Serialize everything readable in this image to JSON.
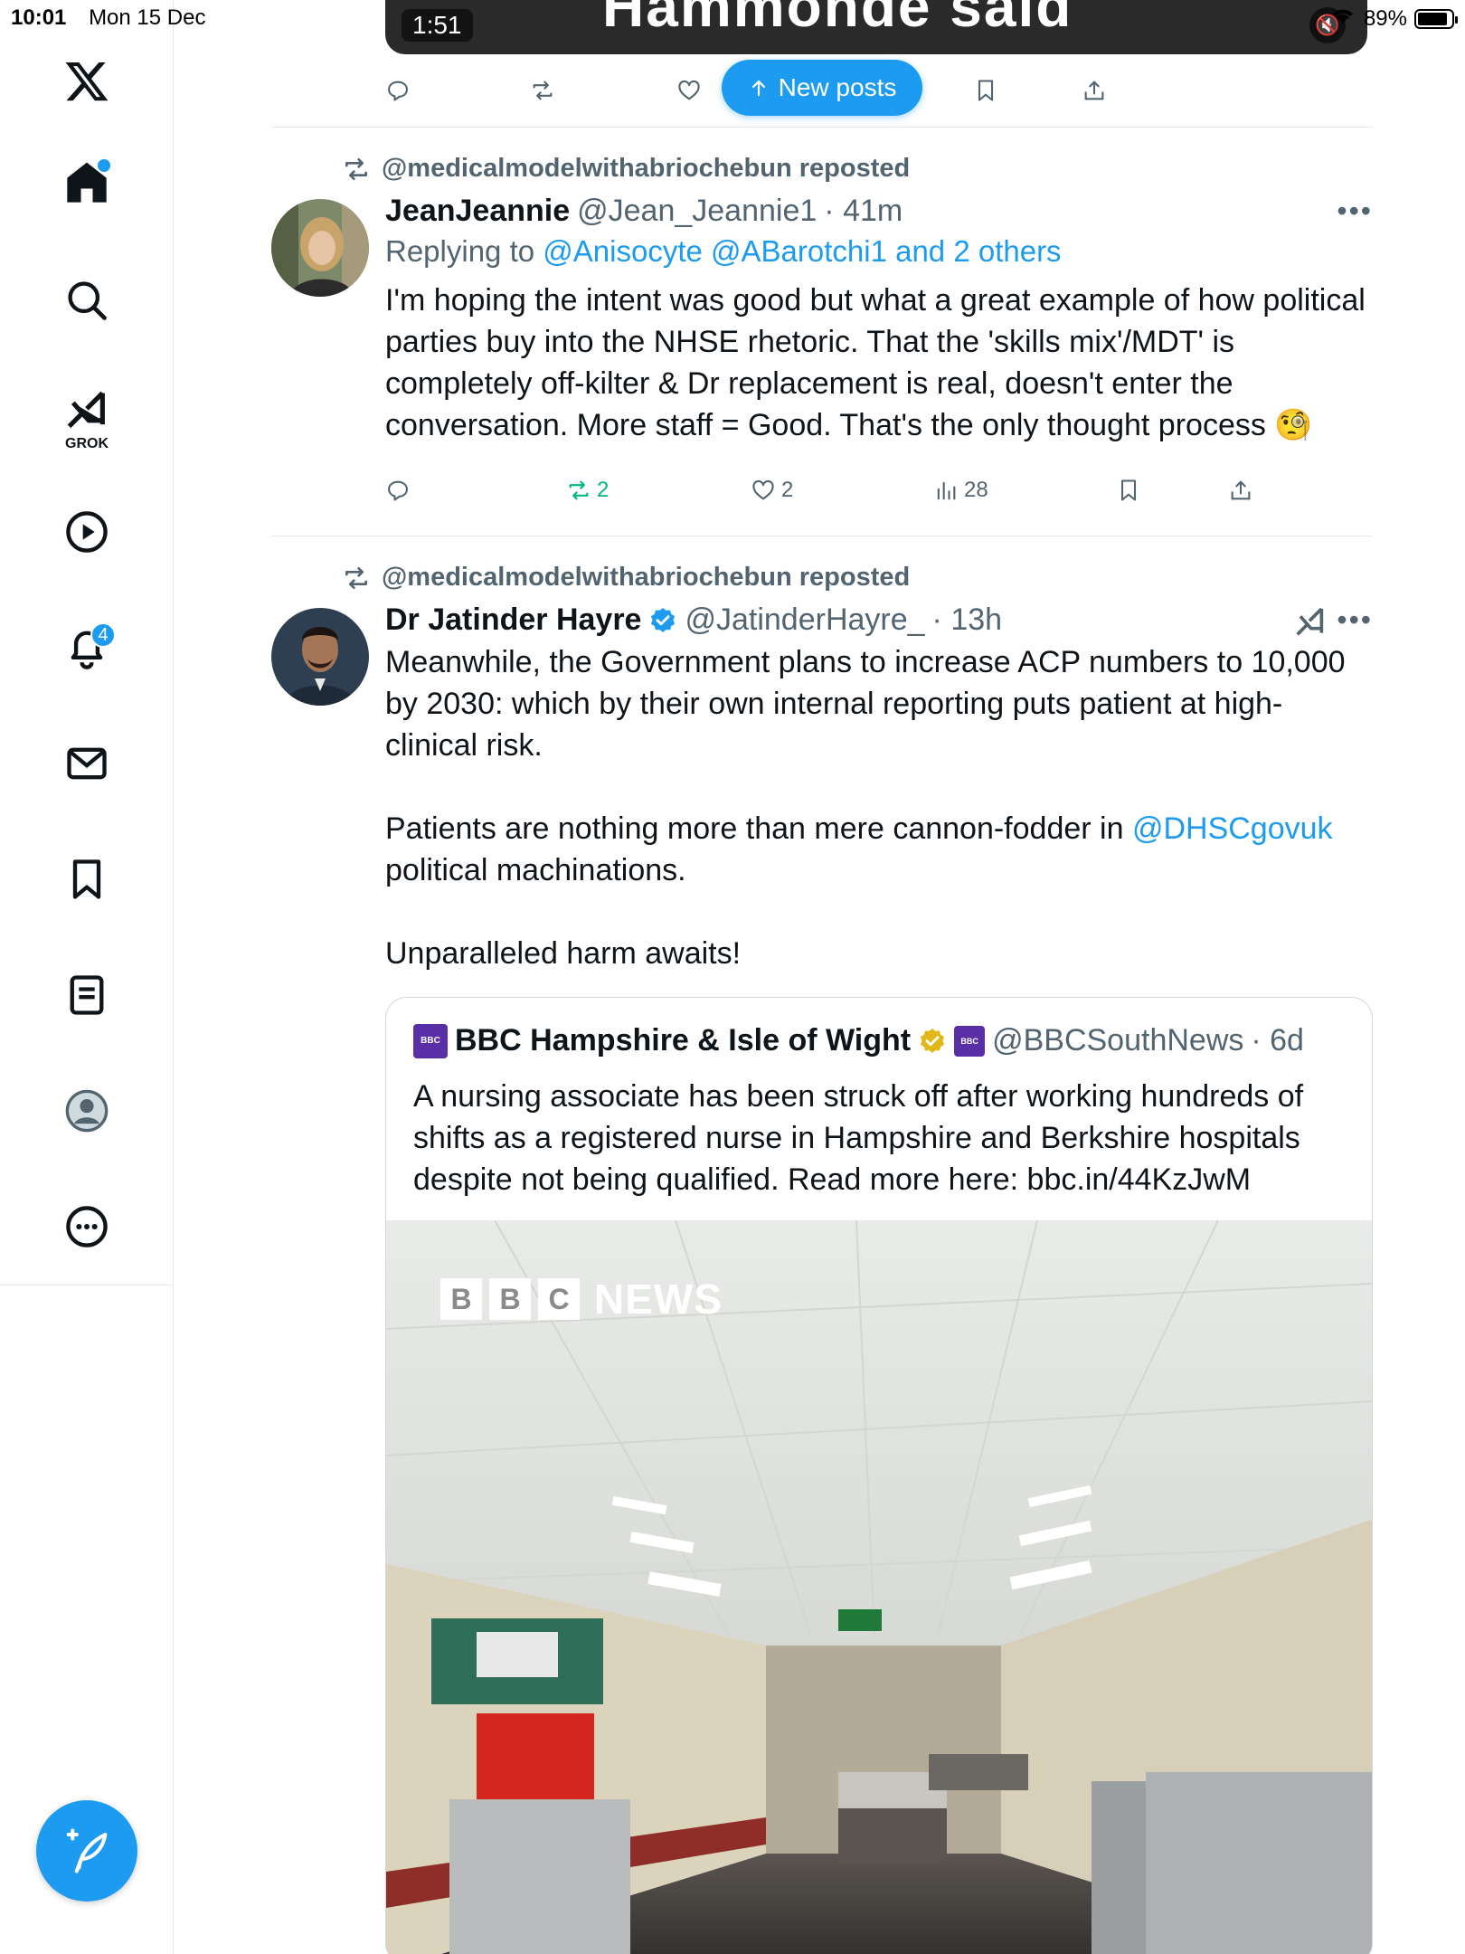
{
  "status_bar": {
    "time": "10:01",
    "date": "Mon 15 Dec",
    "battery": "89%"
  },
  "sidebar": {
    "grok_label": "GROK",
    "notifications_badge": "4"
  },
  "top_post": {
    "video_headline": "Hammonde said",
    "video_time": "1:51"
  },
  "new_posts_label": "New posts",
  "tweets": [
    {
      "repost_label": "@medicalmodelwithabriochebun reposted",
      "author": "JeanJeannie",
      "handle": "@Jean_Jeannie1",
      "time": "· 41m",
      "replying_prefix": "Replying to ",
      "replying_targets": "@Anisocyte @ABarotchi1 and 2 others",
      "text": "I'm hoping the intent was good but what a great example of how political parties buy into the NHSE rhetoric. That the 'skills mix'/MDT' is completely off-kilter & Dr replacement is real, doesn't enter the conversation. More staff = Good. That's the only thought process 🧐",
      "reposts": "2",
      "likes": "2",
      "views": "28"
    },
    {
      "repost_label": "@medicalmodelwithabriochebun reposted",
      "author": "Dr Jatinder Hayre",
      "handle": "@JatinderHayre_",
      "time": "· 13h",
      "text_p1": "Meanwhile, the Government plans to increase ACP numbers to 10,000 by 2030: which by their own internal reporting puts patient at high-clinical risk.",
      "text_p2_a": "Patients are nothing more than mere cannon-fodder in ",
      "text_p2_link": "@DHSCgovuk",
      "text_p2_b": " political machinations.",
      "text_p3": "Unparalleled harm awaits!",
      "quote": {
        "author": "BBC Hampshire & Isle of Wight",
        "handle": "@BBCSouthNews",
        "time": "· 6d",
        "text": "A nursing associate has been struck off after working hundreds of shifts as a registered nurse in Hampshire and Berkshire hospitals despite not being qualified. Read more here: bbc.in/44KzJwM",
        "image_logo_letters": [
          "B",
          "B",
          "C"
        ],
        "image_logo_word": "NEWS"
      }
    }
  ],
  "colors": {
    "accent": "#1d9bf0",
    "text": "#0f1419",
    "muted": "#536471",
    "repost_green": "#00ba7c",
    "border": "#e6e9eb"
  }
}
